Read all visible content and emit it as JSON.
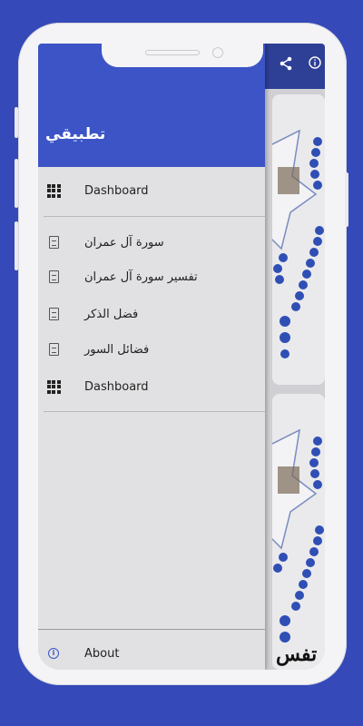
{
  "drawer": {
    "title": "تطبيقي",
    "items": [
      {
        "label": "Dashboard",
        "icon": "grid-icon"
      },
      {
        "label": "سورة آل عمران",
        "icon": "file-icon"
      },
      {
        "label": "تفسير سورة آل عمران",
        "icon": "file-icon"
      },
      {
        "label": "فضل الذكر",
        "icon": "file-icon"
      },
      {
        "label": "فضائل السور",
        "icon": "file-icon"
      },
      {
        "label": "Dashboard",
        "icon": "grid-icon"
      }
    ],
    "footer": {
      "label": "About",
      "icon": "info-icon"
    }
  },
  "app_bar": {
    "icons": [
      "share-icon",
      "info-icon"
    ]
  },
  "content": {
    "caption": "تفس"
  },
  "colors": {
    "background": "#3549b8",
    "drawer_header": "#3c54c6",
    "app_bar": "#2e3f96"
  }
}
